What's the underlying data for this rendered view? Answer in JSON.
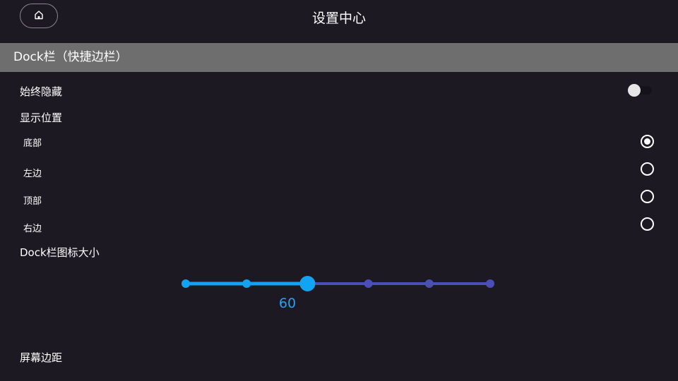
{
  "header": {
    "title": "设置中心",
    "home_icon": "home-icon"
  },
  "section": {
    "title": "Dock栏（快捷边栏）"
  },
  "always_hide": {
    "label": "始终隐藏",
    "enabled": false
  },
  "position": {
    "label": "显示位置",
    "options": [
      {
        "label": "底部",
        "selected": true
      },
      {
        "label": "左边",
        "selected": false
      },
      {
        "label": "顶部",
        "selected": false
      },
      {
        "label": "右边",
        "selected": false
      }
    ]
  },
  "icon_size": {
    "label": "Dock栏图标大小",
    "steps": 6,
    "selected_index": 2,
    "value": "60",
    "active_color": "#12a3f2",
    "inactive_color": "#4a4fb8",
    "value_color": "#2ba0f0"
  },
  "screen_margin": {
    "label": "屏幕边距"
  }
}
